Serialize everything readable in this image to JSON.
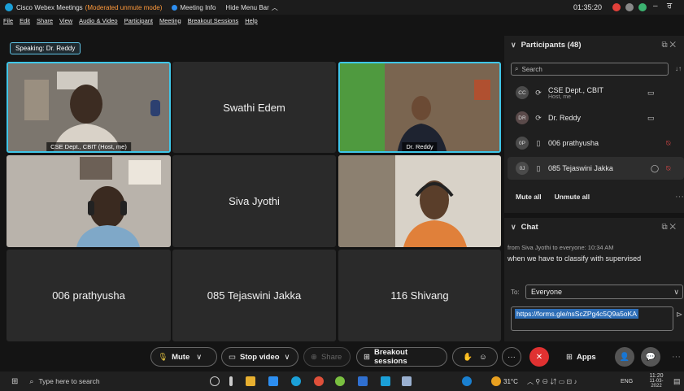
{
  "titlebar": {
    "app": "Cisco Webex Meetings",
    "mode": "(Moderated unmute mode)",
    "meeting_info": "Meeting Info",
    "hide_menu": "Hide Menu Bar",
    "timer": "01:35:20",
    "minimize": "–",
    "restore": "ਰ"
  },
  "menu": [
    "File",
    "Edit",
    "Share",
    "View",
    "Audio & Video",
    "Participant",
    "Meeting",
    "Breakout Sessions",
    "Help"
  ],
  "speaking": "Speaking: Dr. Reddy",
  "tiles": {
    "t1_tag": "CSE Dept., CBIT (Host, me)",
    "t2": "Swathi Edem",
    "t3_tag": "Dr. Reddy",
    "t5": "Siva Jyothi",
    "t7": "006 prathyusha",
    "t8": "085 Tejaswini Jakka",
    "t9": "116 Shivang"
  },
  "participants": {
    "title": "Participants (48)",
    "search_placeholder": "Search",
    "items": [
      {
        "initials": "CC",
        "name": "CSE Dept., CBIT",
        "sub": "Host, me"
      },
      {
        "initials": "DR",
        "name": "Dr. Reddy",
        "sub": ""
      },
      {
        "initials": "0P",
        "name": "006 prathyusha",
        "sub": ""
      },
      {
        "initials": "0J",
        "name": "085 Tejaswini Jakka",
        "sub": ""
      }
    ],
    "mute_all": "Mute all",
    "unmute_all": "Unmute all"
  },
  "chat": {
    "title": "Chat",
    "meta": "from Siva Jyothi to everyone:   10:34 AM",
    "message": "when we have to classify with supervised",
    "to_label": "To:",
    "to_value": "Everyone",
    "input_value": "https://forms.gle/nsScZPg4c5Q9a5oKA"
  },
  "controls": {
    "mute": "Mute",
    "stop_video": "Stop video",
    "share": "Share",
    "breakout": "Breakout sessions",
    "apps": "Apps"
  },
  "taskbar": {
    "search_placeholder": "Type here to search",
    "weather": "31°C",
    "lang": "ENG",
    "time": "11:20",
    "date": "11-03-2022"
  },
  "colors": {
    "accent": "#3fc6e8",
    "end_call": "#e03131",
    "mute_red": "#e04848"
  }
}
